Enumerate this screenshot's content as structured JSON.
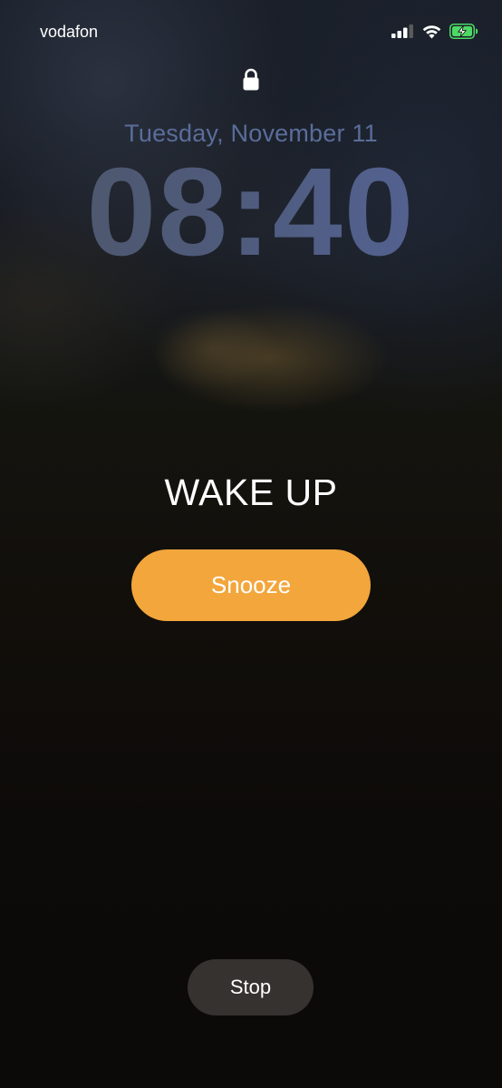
{
  "status_bar": {
    "carrier": "vodafon",
    "icons": [
      "cellular-signal-icon",
      "wifi-icon",
      "battery-charging-icon"
    ],
    "battery_color": "#4cd964"
  },
  "lock_screen": {
    "lock_icon": "lock-icon",
    "date": "Tuesday, November 11",
    "time": "08:40"
  },
  "alarm": {
    "label": "WAKE UP",
    "snooze_label": "Snooze",
    "stop_label": "Stop",
    "snooze_color": "#f2a63c"
  }
}
